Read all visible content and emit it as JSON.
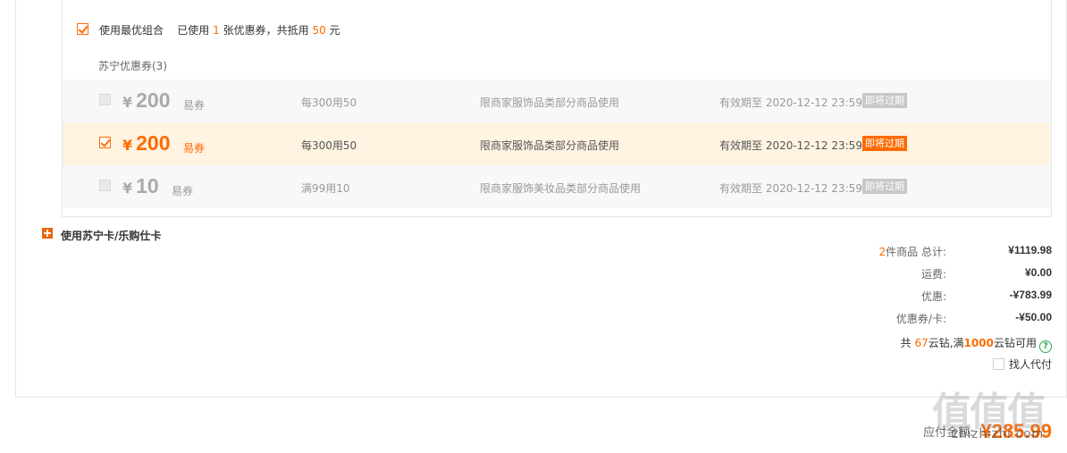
{
  "best_combo": {
    "checked": true,
    "label_prefix": "使用最优组合",
    "used_prefix": "已使用",
    "used_count": "1",
    "used_mid": "张优惠券，共抵用",
    "discount": "50",
    "used_suffix": "元"
  },
  "coupon_section": {
    "title": "苏宁优惠券(3)",
    "coupons": [
      {
        "currency": "¥",
        "amount": "200",
        "type": "易券",
        "rule": "每300用50",
        "scope": "限商家服饰品类部分商品使用",
        "valid": "有效期至 2020-12-12 23:59",
        "badge": "即将过期",
        "checked": false
      },
      {
        "currency": "¥",
        "amount": "200",
        "type": "易券",
        "rule": "每300用50",
        "scope": "限商家服饰品类部分商品使用",
        "valid": "有效期至 2020-12-12 23:59",
        "badge": "即将过期",
        "checked": true
      },
      {
        "currency": "¥",
        "amount": "10",
        "type": "易券",
        "rule": "满99用10",
        "scope": "限商家服饰美妆品类部分商品使用",
        "valid": "有效期至 2020-12-12 23:59",
        "badge": "即将过期",
        "checked": false
      }
    ]
  },
  "card_toggle": {
    "label": "使用苏宁卡/乐购仕卡"
  },
  "summary": {
    "item_count": "2",
    "items_label": "件商品 总计:",
    "total": "¥1119.98",
    "shipping_label": "运费:",
    "shipping": "¥0.00",
    "discount_label": "优惠:",
    "discount": "-¥783.99",
    "coupon_label": "优惠券/卡:",
    "coupon": "-¥50.00"
  },
  "yunzuan": {
    "prefix": "共",
    "count": "67",
    "mid": "云钻,满",
    "threshold": "1000",
    "suffix": "云钻可用"
  },
  "proxy_pay": {
    "label": "找人代付"
  },
  "payable": {
    "label": "应付金额:",
    "amount": "¥285.99"
  },
  "watermark": {
    "glyphs": "值值值",
    "url": "zhizhizhi.com"
  },
  "colors": {
    "accent": "#ff6a00",
    "selected_row_bg": "#fff3e1",
    "help_green": "#2aa84a"
  }
}
